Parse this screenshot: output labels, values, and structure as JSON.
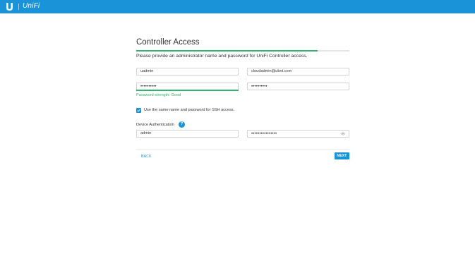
{
  "header": {
    "logo_text": "UniFi",
    "brand_color": "#1a93d8",
    "logo_icon": "ubiquiti-u-icon"
  },
  "page": {
    "title": "Controller Access",
    "subtitle": "Please provide an administrator name and password for UniFi Controller access.",
    "progress_percent": 85
  },
  "form": {
    "admin_name": "uadmin",
    "admin_email": "cloudadmin@ubnt.com",
    "admin_password_mask": "••••••••••",
    "confirm_password_mask": "••••••••••",
    "password_strength": "Password strength: Good",
    "ssh_checkbox_label": "Use the same name and password for SSH access.",
    "ssh_checked": true,
    "device_auth_label": "Device Authentication",
    "device_username": "admin",
    "device_password_mask": "••••••••••••••••"
  },
  "actions": {
    "back_label": "BACK",
    "next_label": "NEXT"
  },
  "colors": {
    "accent": "#1a93d8",
    "success": "#2fb36f"
  }
}
